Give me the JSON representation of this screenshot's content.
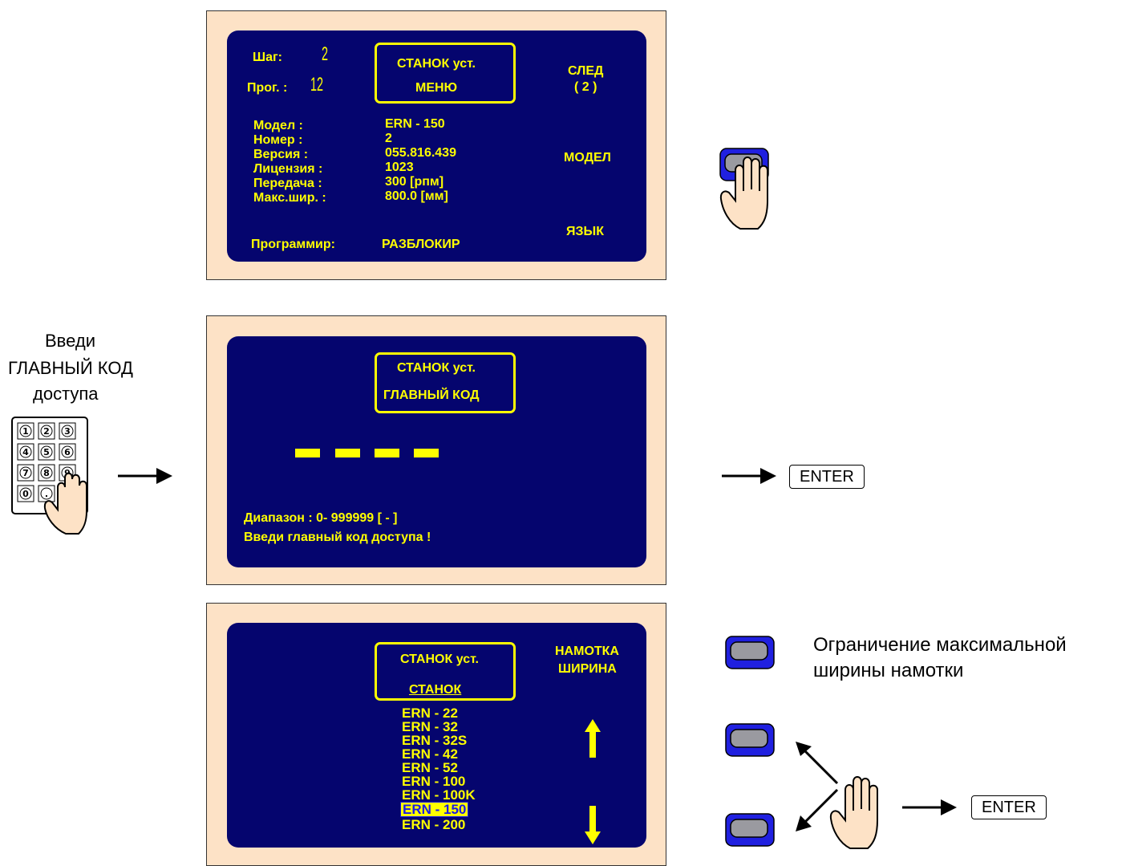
{
  "screen1": {
    "step_label": "Шаг:",
    "step_value": "2",
    "prog_label": "Прог. :",
    "prog_value": "12",
    "title_line1": "СТАНОК уст.",
    "title_line2": "МЕНЮ",
    "softkey_next": "СЛЕД",
    "softkey_next_page": "( 2 )",
    "softkey_model": "МОДЕЛ",
    "softkey_language": "ЯЗЫК",
    "info_labels": [
      "Модел :",
      "Номер :",
      "Версия :",
      "Лицензия :",
      "Передача :",
      "Макс.шир. :"
    ],
    "info_values": [
      "ERN - 150",
      "2",
      "055.816.439",
      "1023",
      "300 [рпм]",
      "800.0 [мм]"
    ],
    "programmer_label": "Программир:",
    "programmer_value": "РАЗБЛОКИР"
  },
  "screen2": {
    "title_line1": "СТАНОК уст.",
    "title_line2": "ГЛАВНЫЙ КОД",
    "range_text": "Диапазон : 0- 999999  [ - ]",
    "prompt_text": "Введи главный код доступа  !"
  },
  "screen3": {
    "title_line1": "СТАНОК  уст.",
    "title_line2": "СТАНОК",
    "softkey_line1": "НАМОТКА",
    "softkey_line2": "ШИРИНА",
    "models": [
      "ERN - 22",
      "ERN - 32",
      "ERN - 32S",
      "ERN - 42",
      "ERN - 52",
      "ERN - 100",
      "ERN - 100K",
      "ERN - 150",
      "ERN - 200"
    ],
    "selected_model": "ERN - 150"
  },
  "instructions": {
    "enter_code_line1": "Введи",
    "enter_code_line2": "ГЛАВНЫЙ КОД",
    "enter_code_line3": "доступа",
    "enter_key_1": "ENTER",
    "enter_key_2": "ENTER",
    "limit_line1": "Ограничение максимальной",
    "limit_line2": "ширины намотки"
  },
  "keypad_digits": [
    "1",
    "2",
    "3",
    "4",
    "5",
    "6",
    "7",
    "8",
    "9",
    "0",
    "."
  ],
  "colors": {
    "panel": "#fde2c6",
    "screen": "#05056e",
    "text": "#ffff00",
    "button_edge": "#1a1ae6",
    "hand": "#fde2c6"
  },
  "icons": [
    "hand-press-icon",
    "keypad-icon",
    "arrow-right-icon",
    "arrow-up-icon",
    "arrow-down-icon"
  ]
}
